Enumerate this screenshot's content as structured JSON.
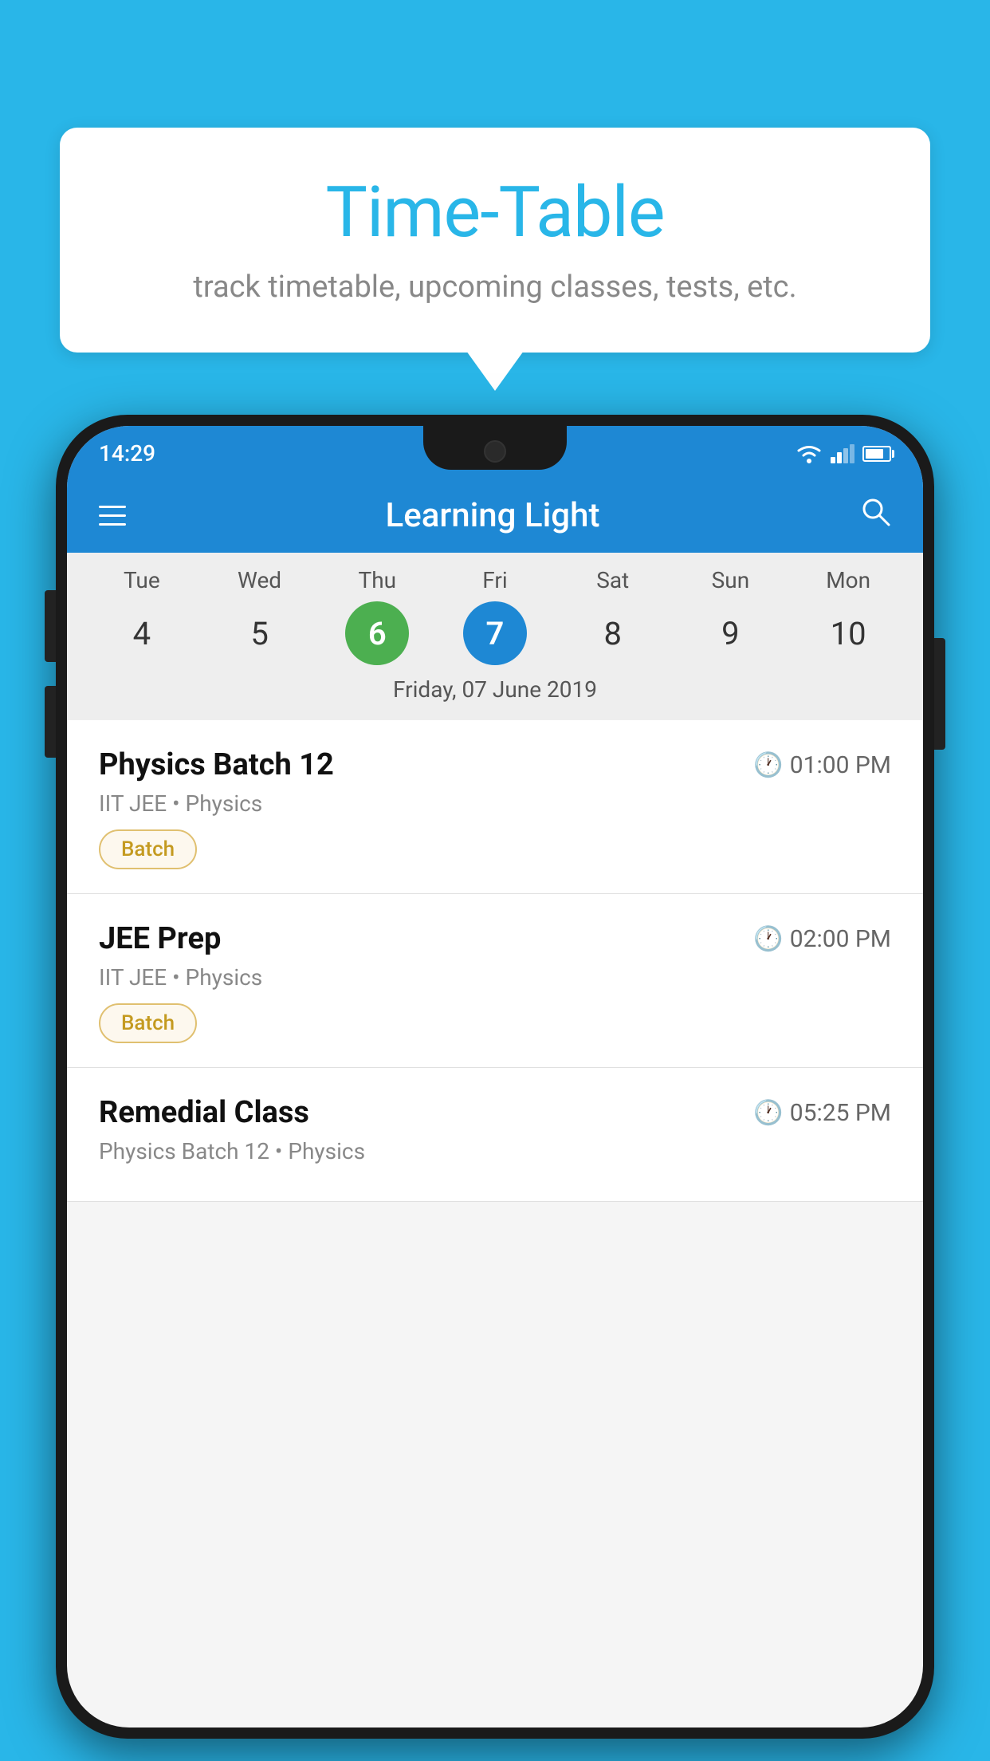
{
  "background_color": "#29b6e8",
  "speech_bubble": {
    "title": "Time-Table",
    "subtitle": "track timetable, upcoming classes, tests, etc."
  },
  "status_bar": {
    "time": "14:29"
  },
  "app_header": {
    "title": "Learning Light"
  },
  "calendar": {
    "days": [
      {
        "name": "Tue",
        "number": "4"
      },
      {
        "name": "Wed",
        "number": "5"
      },
      {
        "name": "Thu",
        "number": "6",
        "state": "today"
      },
      {
        "name": "Fri",
        "number": "7",
        "state": "selected"
      },
      {
        "name": "Sat",
        "number": "8"
      },
      {
        "name": "Sun",
        "number": "9"
      },
      {
        "name": "Mon",
        "number": "10"
      }
    ],
    "selected_date": "Friday, 07 June 2019"
  },
  "classes": [
    {
      "name": "Physics Batch 12",
      "time": "01:00 PM",
      "meta": "IIT JEE • Physics",
      "badge": "Batch"
    },
    {
      "name": "JEE Prep",
      "time": "02:00 PM",
      "meta": "IIT JEE • Physics",
      "badge": "Batch"
    },
    {
      "name": "Remedial Class",
      "time": "05:25 PM",
      "meta": "Physics Batch 12 • Physics",
      "badge": ""
    }
  ]
}
